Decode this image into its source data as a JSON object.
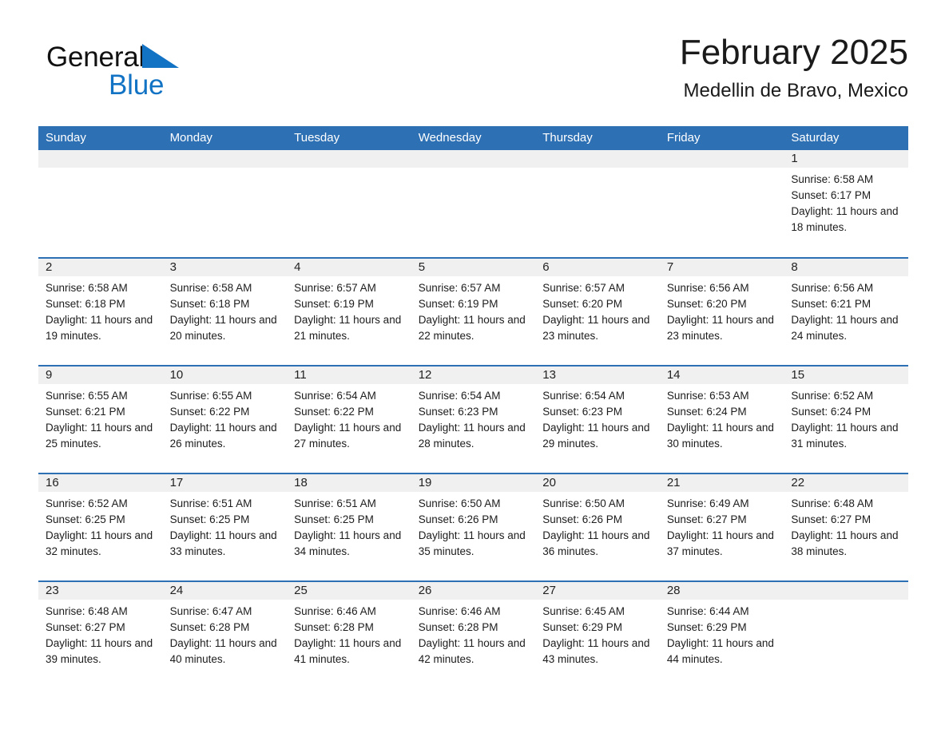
{
  "brand": {
    "name_part1": "General",
    "name_part2": "Blue",
    "triangle_color": "#1273c4",
    "text_color": "#111111"
  },
  "header": {
    "title": "February 2025",
    "subtitle": "Medellin de Bravo, Mexico",
    "accent_color": "#2e70b4",
    "daynum_band_color": "#f0f0f0"
  },
  "weekday_headers": [
    "Sunday",
    "Monday",
    "Tuesday",
    "Wednesday",
    "Thursday",
    "Friday",
    "Saturday"
  ],
  "labels": {
    "sunrise_prefix": "Sunrise: ",
    "sunset_prefix": "Sunset: ",
    "daylight_prefix": "Daylight: "
  },
  "weeks": [
    {
      "days": [
        {
          "date": "",
          "empty": true
        },
        {
          "date": "",
          "empty": true
        },
        {
          "date": "",
          "empty": true
        },
        {
          "date": "",
          "empty": true
        },
        {
          "date": "",
          "empty": true
        },
        {
          "date": "",
          "empty": true
        },
        {
          "date": "1",
          "empty": false,
          "sunrise": "Sunrise: 6:58 AM",
          "sunset": "Sunset: 6:17 PM",
          "daylight": "Daylight: 11 hours and 18 minutes."
        }
      ]
    },
    {
      "days": [
        {
          "date": "2",
          "empty": false,
          "sunrise": "Sunrise: 6:58 AM",
          "sunset": "Sunset: 6:18 PM",
          "daylight": "Daylight: 11 hours and 19 minutes."
        },
        {
          "date": "3",
          "empty": false,
          "sunrise": "Sunrise: 6:58 AM",
          "sunset": "Sunset: 6:18 PM",
          "daylight": "Daylight: 11 hours and 20 minutes."
        },
        {
          "date": "4",
          "empty": false,
          "sunrise": "Sunrise: 6:57 AM",
          "sunset": "Sunset: 6:19 PM",
          "daylight": "Daylight: 11 hours and 21 minutes."
        },
        {
          "date": "5",
          "empty": false,
          "sunrise": "Sunrise: 6:57 AM",
          "sunset": "Sunset: 6:19 PM",
          "daylight": "Daylight: 11 hours and 22 minutes."
        },
        {
          "date": "6",
          "empty": false,
          "sunrise": "Sunrise: 6:57 AM",
          "sunset": "Sunset: 6:20 PM",
          "daylight": "Daylight: 11 hours and 23 minutes."
        },
        {
          "date": "7",
          "empty": false,
          "sunrise": "Sunrise: 6:56 AM",
          "sunset": "Sunset: 6:20 PM",
          "daylight": "Daylight: 11 hours and 23 minutes."
        },
        {
          "date": "8",
          "empty": false,
          "sunrise": "Sunrise: 6:56 AM",
          "sunset": "Sunset: 6:21 PM",
          "daylight": "Daylight: 11 hours and 24 minutes."
        }
      ]
    },
    {
      "days": [
        {
          "date": "9",
          "empty": false,
          "sunrise": "Sunrise: 6:55 AM",
          "sunset": "Sunset: 6:21 PM",
          "daylight": "Daylight: 11 hours and 25 minutes."
        },
        {
          "date": "10",
          "empty": false,
          "sunrise": "Sunrise: 6:55 AM",
          "sunset": "Sunset: 6:22 PM",
          "daylight": "Daylight: 11 hours and 26 minutes."
        },
        {
          "date": "11",
          "empty": false,
          "sunrise": "Sunrise: 6:54 AM",
          "sunset": "Sunset: 6:22 PM",
          "daylight": "Daylight: 11 hours and 27 minutes."
        },
        {
          "date": "12",
          "empty": false,
          "sunrise": "Sunrise: 6:54 AM",
          "sunset": "Sunset: 6:23 PM",
          "daylight": "Daylight: 11 hours and 28 minutes."
        },
        {
          "date": "13",
          "empty": false,
          "sunrise": "Sunrise: 6:54 AM",
          "sunset": "Sunset: 6:23 PM",
          "daylight": "Daylight: 11 hours and 29 minutes."
        },
        {
          "date": "14",
          "empty": false,
          "sunrise": "Sunrise: 6:53 AM",
          "sunset": "Sunset: 6:24 PM",
          "daylight": "Daylight: 11 hours and 30 minutes."
        },
        {
          "date": "15",
          "empty": false,
          "sunrise": "Sunrise: 6:52 AM",
          "sunset": "Sunset: 6:24 PM",
          "daylight": "Daylight: 11 hours and 31 minutes."
        }
      ]
    },
    {
      "days": [
        {
          "date": "16",
          "empty": false,
          "sunrise": "Sunrise: 6:52 AM",
          "sunset": "Sunset: 6:25 PM",
          "daylight": "Daylight: 11 hours and 32 minutes."
        },
        {
          "date": "17",
          "empty": false,
          "sunrise": "Sunrise: 6:51 AM",
          "sunset": "Sunset: 6:25 PM",
          "daylight": "Daylight: 11 hours and 33 minutes."
        },
        {
          "date": "18",
          "empty": false,
          "sunrise": "Sunrise: 6:51 AM",
          "sunset": "Sunset: 6:25 PM",
          "daylight": "Daylight: 11 hours and 34 minutes."
        },
        {
          "date": "19",
          "empty": false,
          "sunrise": "Sunrise: 6:50 AM",
          "sunset": "Sunset: 6:26 PM",
          "daylight": "Daylight: 11 hours and 35 minutes."
        },
        {
          "date": "20",
          "empty": false,
          "sunrise": "Sunrise: 6:50 AM",
          "sunset": "Sunset: 6:26 PM",
          "daylight": "Daylight: 11 hours and 36 minutes."
        },
        {
          "date": "21",
          "empty": false,
          "sunrise": "Sunrise: 6:49 AM",
          "sunset": "Sunset: 6:27 PM",
          "daylight": "Daylight: 11 hours and 37 minutes."
        },
        {
          "date": "22",
          "empty": false,
          "sunrise": "Sunrise: 6:48 AM",
          "sunset": "Sunset: 6:27 PM",
          "daylight": "Daylight: 11 hours and 38 minutes."
        }
      ]
    },
    {
      "days": [
        {
          "date": "23",
          "empty": false,
          "sunrise": "Sunrise: 6:48 AM",
          "sunset": "Sunset: 6:27 PM",
          "daylight": "Daylight: 11 hours and 39 minutes."
        },
        {
          "date": "24",
          "empty": false,
          "sunrise": "Sunrise: 6:47 AM",
          "sunset": "Sunset: 6:28 PM",
          "daylight": "Daylight: 11 hours and 40 minutes."
        },
        {
          "date": "25",
          "empty": false,
          "sunrise": "Sunrise: 6:46 AM",
          "sunset": "Sunset: 6:28 PM",
          "daylight": "Daylight: 11 hours and 41 minutes."
        },
        {
          "date": "26",
          "empty": false,
          "sunrise": "Sunrise: 6:46 AM",
          "sunset": "Sunset: 6:28 PM",
          "daylight": "Daylight: 11 hours and 42 minutes."
        },
        {
          "date": "27",
          "empty": false,
          "sunrise": "Sunrise: 6:45 AM",
          "sunset": "Sunset: 6:29 PM",
          "daylight": "Daylight: 11 hours and 43 minutes."
        },
        {
          "date": "28",
          "empty": false,
          "sunrise": "Sunrise: 6:44 AM",
          "sunset": "Sunset: 6:29 PM",
          "daylight": "Daylight: 11 hours and 44 minutes."
        },
        {
          "date": "",
          "empty": true
        }
      ]
    }
  ]
}
